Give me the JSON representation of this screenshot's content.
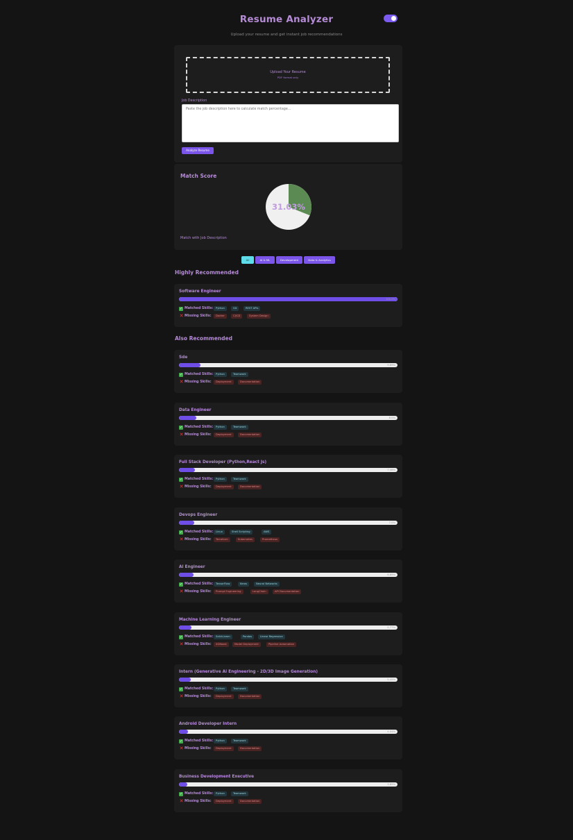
{
  "header": {
    "title": "Resume Analyzer",
    "subtitle": "Upload your resume and get instant job recommendations",
    "toggle_on": true
  },
  "upload": {
    "title": "Upload Your Resume",
    "subtitle": "PDF format only",
    "jd_label": "Job Description",
    "jd_placeholder": "Paste the job description here to calculate match percentage...",
    "analyze_label": "Analyze Resume"
  },
  "match": {
    "title": "Match Score",
    "value": 31.03,
    "label": "31.03%",
    "caption": "Match with Job Description",
    "colors": {
      "matched": "#5b8a52",
      "rest": "#f0f0f0"
    }
  },
  "filters": {
    "items": [
      {
        "label": "All",
        "active": true
      },
      {
        "label": "AI & ML",
        "active": false
      },
      {
        "label": "Development",
        "active": false
      },
      {
        "label": "Data & Analytics",
        "active": false
      }
    ]
  },
  "labels": {
    "highly": "Highly Recommended",
    "also": "Also Recommended",
    "matched": "Matched Skills:",
    "missing": "Missing Skills:"
  },
  "colors": {
    "accent": "#7b55ea",
    "title": "#b58bd6",
    "match_tag": "#22363d",
    "miss_tag": "#4a2323"
  },
  "jobs": [
    {
      "title": "Software Engineer",
      "pct": 100,
      "pct_label": "100.0%",
      "matched": [
        "Python",
        "Git",
        "REST APIs"
      ],
      "missing": [
        "Docker",
        "CI/CD",
        "System Design"
      ]
    },
    {
      "title": "Sde",
      "pct": 9.89,
      "pct_label": "9.89%",
      "matched": [
        "Python",
        "Teamwork"
      ],
      "missing": [
        "Deployment",
        "Documentation"
      ]
    },
    {
      "title": "Data Engineer",
      "pct": 8.0,
      "pct_label": "8.0%",
      "matched": [
        "Python",
        "Teamwork"
      ],
      "missing": [
        "Deployment",
        "Documentation"
      ]
    },
    {
      "title": "Full Stack Developer (Python,React Js)",
      "pct": 7.46,
      "pct_label": "7.46%",
      "matched": [
        "Python",
        "Teamwork"
      ],
      "missing": [
        "Deployment",
        "Documentation"
      ]
    },
    {
      "title": "Devops Engineer",
      "pct": 7.0,
      "pct_label": "7.0%",
      "matched": [
        "Linux",
        "Shell Scripting",
        "AWS"
      ],
      "missing": [
        "Terraform",
        "Kubernetes",
        "Prometheus"
      ]
    },
    {
      "title": "Ai Engineer",
      "pct": 6.69,
      "pct_label": "6.69%",
      "matched": [
        "TensorFlow",
        "Keras",
        "Neural Networks"
      ],
      "missing": [
        "Prompt Engineering",
        "LangChain",
        "API Documentation"
      ]
    },
    {
      "title": "Machine Learning Engineer",
      "pct": 5.77,
      "pct_label": "5.77%",
      "matched": [
        "Scikit-learn",
        "Pandas",
        "Linear Regression"
      ],
      "missing": [
        "XGBoost",
        "Model Deployment",
        "Pipeline Automation"
      ]
    },
    {
      "title": "Intern (Generative Ai Engineering - 2D/3D Image Generation)",
      "pct": 5.45,
      "pct_label": "5.45%",
      "matched": [
        "Python",
        "Teamwork"
      ],
      "missing": [
        "Deployment",
        "Documentation"
      ]
    },
    {
      "title": "Android Developer Intern",
      "pct": 4.04,
      "pct_label": "4.04%",
      "matched": [
        "Python",
        "Teamwork"
      ],
      "missing": [
        "Deployment",
        "Documentation"
      ]
    },
    {
      "title": "Business Development Executive",
      "pct": 3.85,
      "pct_label": "3.85%",
      "matched": [
        "Python",
        "Teamwork"
      ],
      "missing": [
        "Deployment",
        "Documentation"
      ]
    }
  ]
}
